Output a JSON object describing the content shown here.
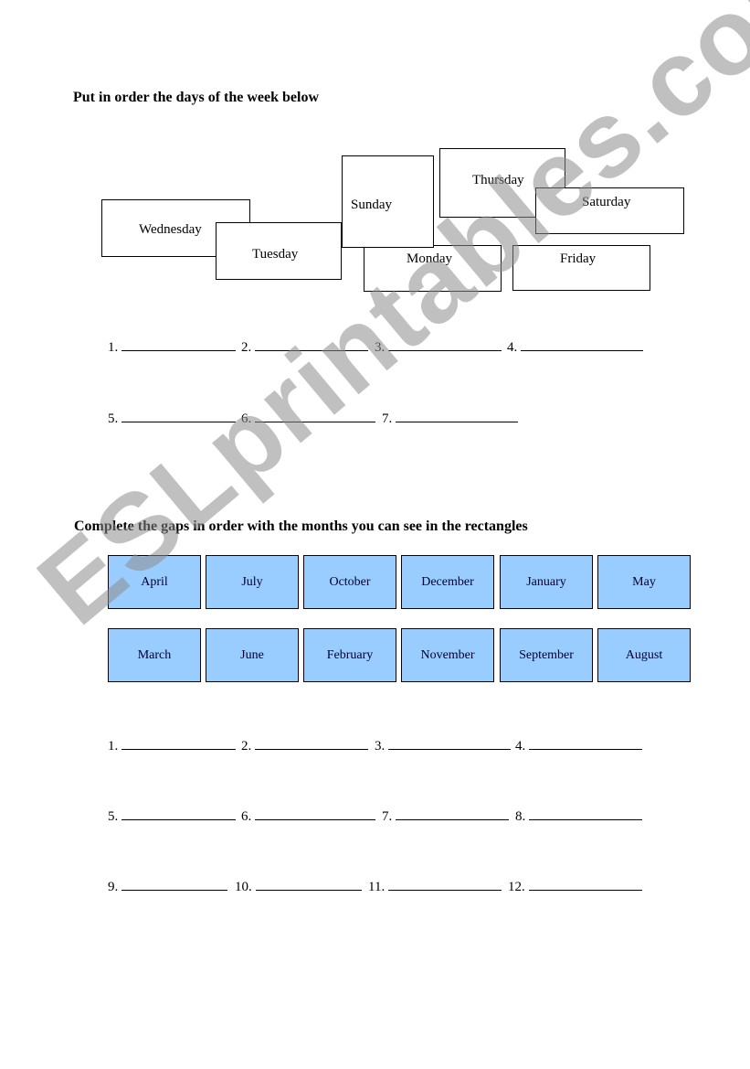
{
  "section1": {
    "heading": "Put in order the days of the week below",
    "days": [
      "Wednesday",
      "Tuesday",
      "Sunday",
      "Monday",
      "Thursday",
      "Saturday",
      "Friday"
    ],
    "blanks_row1": [
      "1.",
      "2.",
      "3.",
      "4."
    ],
    "blanks_row2": [
      "5.",
      "6.",
      "7."
    ]
  },
  "section2": {
    "heading": "Complete the gaps in order with the months you can see in the rectangles",
    "months_row1": [
      "April",
      "July",
      "October",
      "December",
      "January",
      "May"
    ],
    "months_row2": [
      "March",
      "June",
      "February",
      "November",
      "September",
      "August"
    ],
    "box_color": "#99ccff",
    "blanks_row1": [
      "1.",
      "2.",
      "3.",
      "4."
    ],
    "blanks_row2": [
      "5.",
      "6.",
      "7.",
      "8."
    ],
    "blanks_row3": [
      "9.",
      "10.",
      "11.",
      "12."
    ]
  },
  "watermark": "ESLprintables.com"
}
